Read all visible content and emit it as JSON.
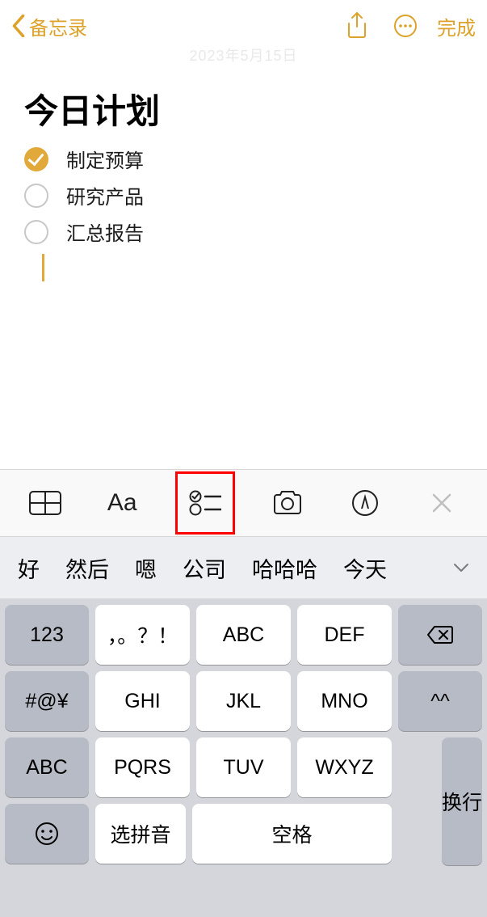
{
  "nav": {
    "back_label": "备忘录",
    "done_label": "完成"
  },
  "timestamp": "2023年5月15日",
  "note": {
    "title": "今日计划",
    "items": [
      {
        "checked": true,
        "text": "制定预算"
      },
      {
        "checked": false,
        "text": "研究产品"
      },
      {
        "checked": false,
        "text": "汇总报告"
      }
    ]
  },
  "fmt": {
    "text_style": "Aa",
    "close": "×"
  },
  "candidates": [
    "好",
    "然后",
    "嗯",
    "公司",
    "哈哈哈",
    "今天"
  ],
  "keys": {
    "r1": [
      "123",
      "，。？！",
      "ABC",
      "DEF"
    ],
    "r2": [
      "#@¥",
      "GHI",
      "JKL",
      "MNO",
      "^^"
    ],
    "r3": [
      "ABC",
      "PQRS",
      "TUV",
      "WXYZ"
    ],
    "r4_pinyin": "选拼音",
    "r4_space": "空格",
    "r4_enter": "换行"
  }
}
